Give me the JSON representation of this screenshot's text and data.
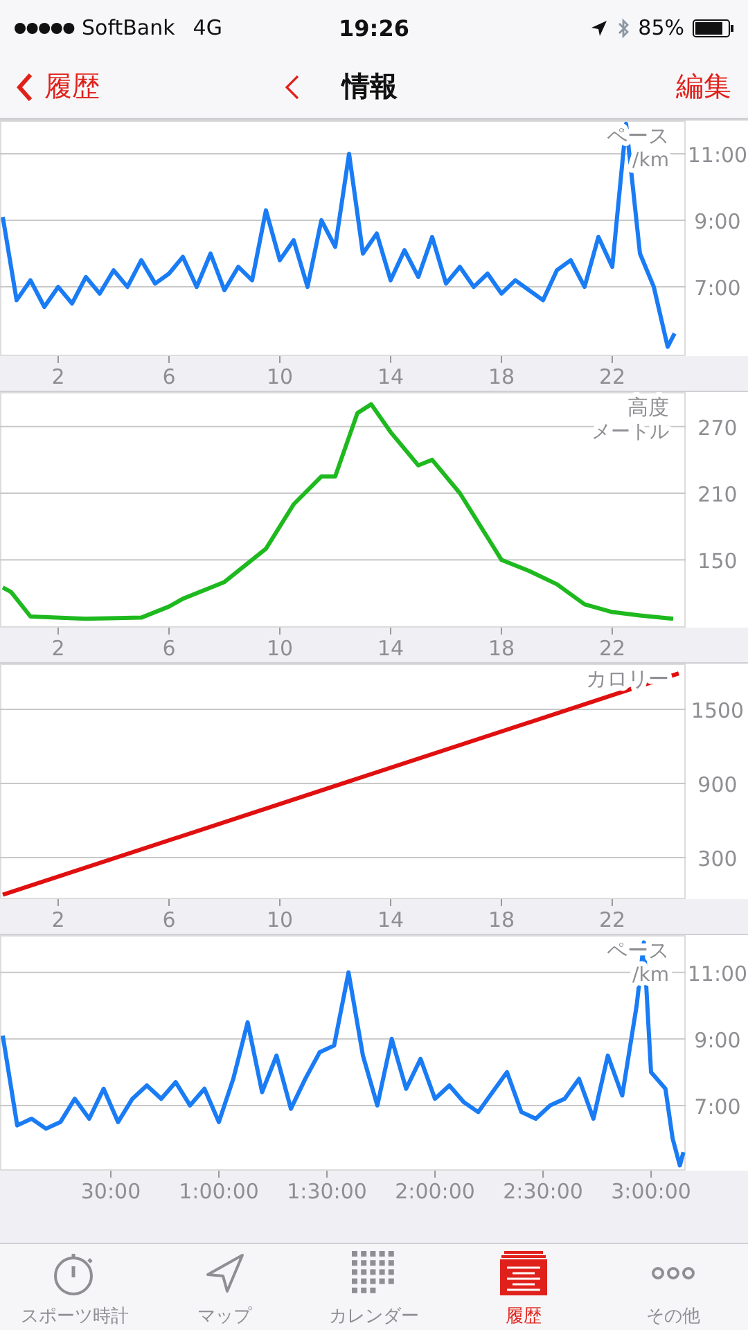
{
  "status_bar": {
    "carrier": "SoftBank",
    "network": "4G",
    "time": "19:26",
    "battery": "85%"
  },
  "nav_bar": {
    "back": "履歴",
    "title": "情報",
    "action": "編集"
  },
  "panels": [
    {
      "unit": "/km",
      "chart_data": {
        "type": "line",
        "ylabel": "ペース",
        "x": [
          0,
          0.5,
          1,
          1.5,
          2,
          2.5,
          3,
          3.5,
          4,
          4.5,
          5,
          5.5,
          6,
          6.5,
          7,
          7.5,
          8,
          8.5,
          9,
          9.5,
          10,
          10.5,
          11,
          11.5,
          12,
          12.5,
          13,
          13.5,
          14,
          14.5,
          15,
          15.5,
          16,
          16.5,
          17,
          17.5,
          18,
          18.5,
          19,
          19.5,
          20,
          20.5,
          21,
          21.5,
          22,
          22.5,
          23,
          23.5,
          24,
          24.25
        ],
        "series": [
          {
            "color": "#1a7cf5",
            "values": [
              9.1,
              6.6,
              7.2,
              6.4,
              7.0,
              6.5,
              7.3,
              6.8,
              7.5,
              7.0,
              7.8,
              7.1,
              7.4,
              7.9,
              7.0,
              8.0,
              6.9,
              7.6,
              7.2,
              9.3,
              7.8,
              8.4,
              7.0,
              9.0,
              8.2,
              11.0,
              8.0,
              8.6,
              7.2,
              8.1,
              7.3,
              8.5,
              7.1,
              7.6,
              7.0,
              7.4,
              6.8,
              7.2,
              6.9,
              6.6,
              7.5,
              7.8,
              7.0,
              8.5,
              7.6,
              11.9,
              8.0,
              7.0,
              5.2,
              5.6
            ]
          }
        ],
        "xlim": [
          -0.1,
          24.65
        ],
        "ylim": [
          4.92,
          12
        ],
        "grid": true,
        "xticks": [
          2,
          6,
          10,
          14,
          18,
          22
        ],
        "yticks": [
          {
            "value": 7,
            "label": "7:00"
          },
          {
            "value": 9,
            "label": "9:00"
          },
          {
            "value": 11,
            "label": "11:00"
          }
        ]
      }
    },
    {
      "unit": "メートル",
      "chart_data": {
        "type": "line",
        "ylabel": "高度",
        "x": [
          0,
          0.3,
          1,
          3,
          5,
          6,
          6.5,
          8,
          9.5,
          10.5,
          11.5,
          12,
          12.8,
          13.3,
          14,
          15,
          15.5,
          16.5,
          17.5,
          18,
          19,
          20,
          21,
          22,
          23,
          24.2
        ],
        "series": [
          {
            "color": "#1eb91e",
            "values": [
              125,
              121,
              99,
              97,
              98,
              108,
              115,
              130,
              160,
              200,
              225,
              225,
              282,
              290,
              265,
              235,
              240,
              210,
              170,
              150,
              140,
              128,
              110,
              103,
              100,
              97
            ]
          }
        ],
        "xlim": [
          -0.1,
          24.65
        ],
        "ylim": [
          89,
          301
        ],
        "grid": true,
        "xticks": [
          2,
          6,
          10,
          14,
          18,
          22
        ],
        "yticks": [
          150,
          210,
          270
        ]
      }
    },
    {
      "chart_data": {
        "type": "line",
        "ylabel": "カロリー",
        "x": [
          0,
          24.4
        ],
        "series": [
          {
            "color": "#e01010",
            "values": [
              0,
              1790
            ]
          }
        ],
        "xlim": [
          -0.1,
          24.65
        ],
        "ylim": [
          -36,
          1870
        ],
        "grid": true,
        "xticks": [
          2,
          6,
          10,
          14,
          18,
          22
        ],
        "yticks": [
          300,
          900,
          1500
        ]
      }
    },
    {
      "unit": "/km",
      "chart_data": {
        "type": "line",
        "ylabel": "ペース",
        "x": [
          0,
          4,
          8,
          12,
          16,
          20,
          24,
          28,
          32,
          36,
          40,
          44,
          48,
          52,
          56,
          60,
          64,
          68,
          72,
          76,
          80,
          84,
          88,
          92,
          96,
          100,
          104,
          108,
          112,
          116,
          120,
          124,
          128,
          132,
          136,
          140,
          144,
          148,
          152,
          156,
          160,
          164,
          168,
          172,
          176,
          178,
          180,
          184,
          186,
          188,
          189
        ],
        "series": [
          {
            "color": "#1a7cf5",
            "values": [
              9.1,
              6.4,
              6.6,
              6.3,
              6.5,
              7.2,
              6.6,
              7.5,
              6.5,
              7.2,
              7.6,
              7.2,
              7.7,
              7.0,
              7.5,
              6.5,
              7.8,
              9.5,
              7.4,
              8.5,
              6.9,
              7.8,
              8.6,
              8.8,
              11.0,
              8.5,
              7.0,
              9.0,
              7.5,
              8.4,
              7.2,
              7.6,
              7.1,
              6.8,
              7.4,
              8.0,
              6.8,
              6.6,
              7.0,
              7.2,
              7.8,
              6.6,
              8.5,
              7.3,
              10.0,
              11.9,
              8.0,
              7.5,
              6.0,
              5.2,
              5.6
            ]
          }
        ],
        "xlim": [
          -0.77,
          189.6
        ],
        "ylim": [
          5.04,
          12.12
        ],
        "grid": true,
        "xticks": [
          {
            "value": 30,
            "label": "30:00"
          },
          {
            "value": 60,
            "label": "1:00:00"
          },
          {
            "value": 90,
            "label": "1:30:00"
          },
          {
            "value": 120,
            "label": "2:00:00"
          },
          {
            "value": 150,
            "label": "2:30:00"
          },
          {
            "value": 180,
            "label": "3:00:00"
          }
        ],
        "yticks": [
          {
            "value": 7,
            "label": "7:00"
          },
          {
            "value": 9,
            "label": "9:00"
          },
          {
            "value": 11,
            "label": "11:00"
          }
        ]
      }
    }
  ],
  "tabs": [
    {
      "label": "スポーツ時計",
      "selected": false
    },
    {
      "label": "マップ",
      "selected": false
    },
    {
      "label": "カレンダー",
      "selected": false
    },
    {
      "label": "履歴",
      "selected": true
    },
    {
      "label": "その他",
      "selected": false
    }
  ]
}
